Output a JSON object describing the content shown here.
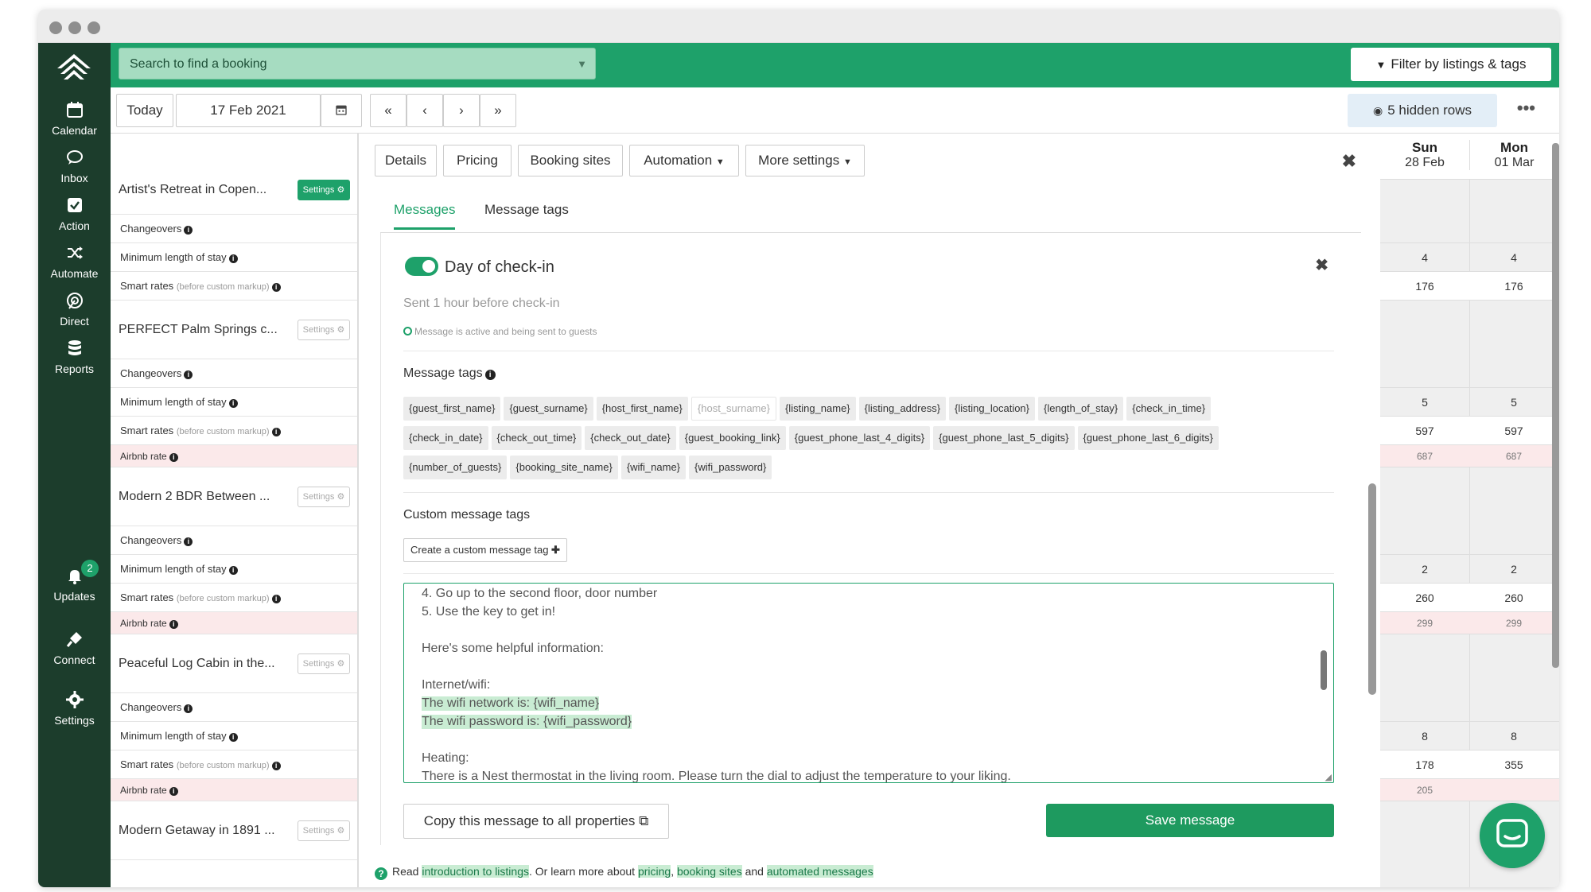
{
  "topbar": {
    "search_placeholder": "Search to find a booking",
    "filter_label": "Filter by listings & tags"
  },
  "nav": [
    {
      "label": "Calendar",
      "icon": "calendar-icon"
    },
    {
      "label": "Inbox",
      "icon": "chat-icon"
    },
    {
      "label": "Action",
      "icon": "checkbox-icon"
    },
    {
      "label": "Automate",
      "icon": "shuffle-icon"
    },
    {
      "label": "Direct",
      "icon": "direct-icon"
    },
    {
      "label": "Reports",
      "icon": "database-icon"
    },
    {
      "label": "Updates",
      "icon": "bell-icon",
      "badge": "2"
    },
    {
      "label": "Connect",
      "icon": "plug-icon"
    },
    {
      "label": "Settings",
      "icon": "gear-icon"
    }
  ],
  "toolbar": {
    "today": "Today",
    "date": "17 Feb 2021",
    "first": "«",
    "prev": "‹",
    "next": "›",
    "last": "»",
    "hidden_rows": "5 hidden rows",
    "more": "•••"
  },
  "listings": [
    {
      "name": "Artist's Retreat in Copen...",
      "settings": "Settings"
    },
    {
      "name": "PERFECT Palm Springs c...",
      "settings": "Settings"
    },
    {
      "name": "Modern 2 BDR Between ...",
      "settings": "Settings"
    },
    {
      "name": "Peaceful Log Cabin in the...",
      "settings": "Settings"
    },
    {
      "name": "Modern Getaway in 1891 ...",
      "settings": "Settings"
    }
  ],
  "row_labels": {
    "changeovers": "Changeovers",
    "min_stay": "Minimum length of stay",
    "smart_rates": "Smart rates",
    "smart_rates_note": "(before custom markup)",
    "airbnb_rate": "Airbnb rate"
  },
  "calendar": {
    "days": [
      {
        "dow": "Sun",
        "date": "28 Feb"
      },
      {
        "dow": "Mon",
        "date": "01 Mar"
      }
    ],
    "rows": [
      {
        "min": [
          "4",
          "4"
        ],
        "smart": [
          "176",
          "176"
        ]
      },
      {
        "min": [
          "5",
          "5"
        ],
        "smart": [
          "597",
          "597"
        ],
        "airbnb": [
          "687",
          "687"
        ]
      },
      {
        "min": [
          "2",
          "2"
        ],
        "smart": [
          "260",
          "260"
        ],
        "airbnb": [
          "299",
          "299"
        ]
      },
      {
        "min": [
          "8",
          "8"
        ],
        "smart": [
          "178",
          "355"
        ],
        "airbnb": [
          "205",
          ""
        ]
      }
    ]
  },
  "modal": {
    "tabs": [
      "Details",
      "Pricing",
      "Booking sites",
      "Automation",
      "More settings"
    ],
    "subtabs": [
      "Messages",
      "Message tags"
    ],
    "message_title": "Day of check-in",
    "sent_text": "Sent 1 hour before check-in",
    "active_text": "Message is active and being sent to guests",
    "message_tags_label": "Message tags",
    "tags": [
      "{guest_first_name}",
      "{guest_surname}",
      "{host_first_name}",
      "{host_surname}",
      "{listing_name}",
      "{listing_address}",
      "{listing_location}",
      "{length_of_stay}",
      "{check_in_time}",
      "{check_in_date}",
      "{check_out_time}",
      "{check_out_date}",
      "{guest_booking_link}",
      "{guest_phone_last_4_digits}",
      "{guest_phone_last_5_digits}",
      "{guest_phone_last_6_digits}",
      "{number_of_guests}",
      "{booking_site_name}",
      "{wifi_name}",
      "{wifi_password}"
    ],
    "custom_tags_label": "Custom message tags",
    "create_tag": "Create a custom message tag",
    "message_lines": [
      "4. Go up to the second floor, door number",
      "5. Use the key to get in!",
      "",
      "Here's some helpful information:",
      "",
      "Internet/wifi:",
      "The wifi network is: {wifi_name}",
      "The wifi password is: {wifi_password}",
      "",
      "Heating:",
      "There is a Nest thermostat in the living room. Please turn the dial to adjust the temperature to your liking."
    ],
    "copy_button": "Copy this message to all properties",
    "save_button": "Save message"
  },
  "footer": {
    "prefix": "Read",
    "link1": "introduction to listings",
    "mid": ". Or learn more about",
    "link2": "pricing",
    "comma": ",",
    "link3": "booking sites",
    "and": "and",
    "link4": "automated messages"
  },
  "colors": {
    "brand_green": "#1ea16a",
    "nav_dark": "#1c3d2c"
  }
}
